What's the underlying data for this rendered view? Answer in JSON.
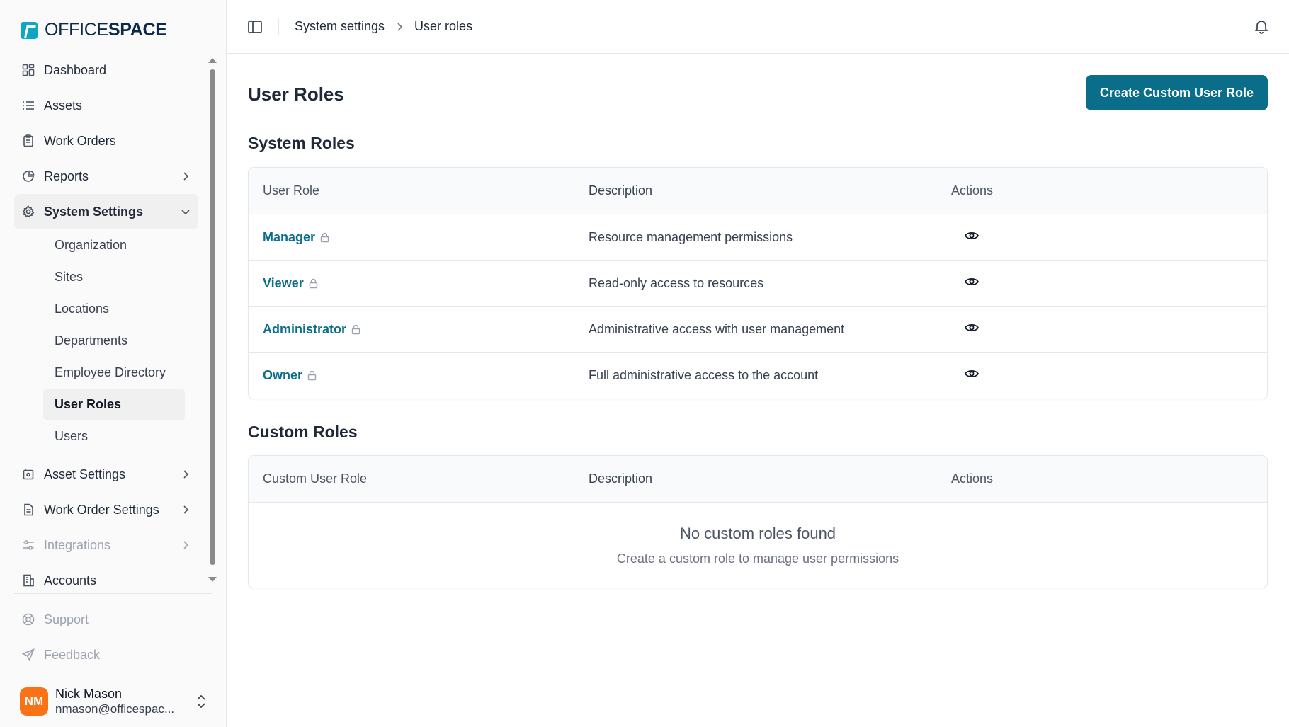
{
  "brand": {
    "name_light": "OFFICE",
    "name_bold": "SPACE",
    "accent": "#0ea5c6"
  },
  "sidebar": {
    "items": [
      {
        "label": "Dashboard",
        "icon": "dashboard-icon"
      },
      {
        "label": "Assets",
        "icon": "list-icon"
      },
      {
        "label": "Work Orders",
        "icon": "clipboard-icon"
      },
      {
        "label": "Reports",
        "icon": "pie-chart-icon"
      },
      {
        "label": "System Settings",
        "icon": "gear-icon"
      }
    ],
    "system_settings_sub": [
      "Organization",
      "Sites",
      "Locations",
      "Departments",
      "Employee Directory",
      "User Roles",
      "Users"
    ],
    "more_items": [
      {
        "label": "Asset Settings"
      },
      {
        "label": "Work Order Settings"
      },
      {
        "label": "Integrations"
      },
      {
        "label": "Accounts"
      }
    ],
    "bottom": {
      "support": "Support",
      "feedback": "Feedback"
    },
    "user": {
      "initials": "NM",
      "name": "Nick Mason",
      "email": "nmason@officespac..."
    }
  },
  "header": {
    "breadcrumb": [
      "System settings",
      "User roles"
    ]
  },
  "main": {
    "title": "User Roles",
    "create_button": "Create Custom User Role",
    "system_roles": {
      "title": "System Roles",
      "columns": [
        "User Role",
        "Description",
        "Actions"
      ],
      "rows": [
        {
          "role": "Manager",
          "description": "Resource management permissions"
        },
        {
          "role": "Viewer",
          "description": "Read-only access to resources"
        },
        {
          "role": "Administrator",
          "description": "Administrative access with user management"
        },
        {
          "role": "Owner",
          "description": "Full administrative access to the account"
        }
      ]
    },
    "custom_roles": {
      "title": "Custom Roles",
      "columns": [
        "Custom User Role",
        "Description",
        "Actions"
      ],
      "empty_title": "No custom roles found",
      "empty_subtitle": "Create a custom role to manage user permissions"
    }
  },
  "colors": {
    "primary": "#0a6e8a",
    "avatar": "#f97316"
  }
}
